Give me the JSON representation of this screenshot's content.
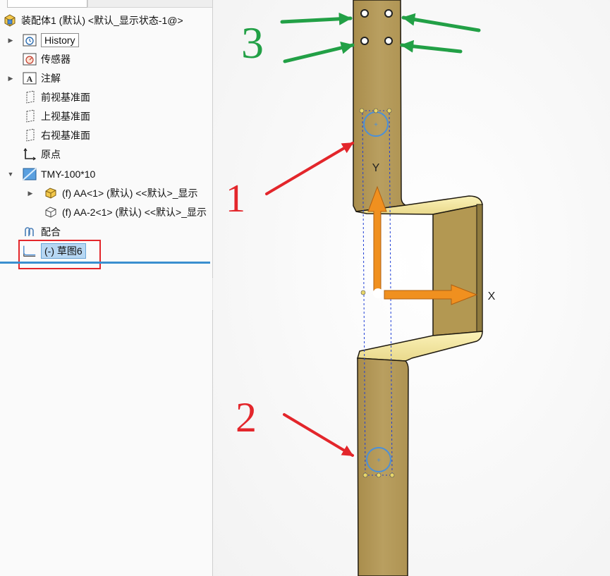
{
  "tree": {
    "root_label": "装配体1 (默认) <默认_显示状态-1@>",
    "items": [
      {
        "label": "History",
        "icon": "history-icon",
        "expandable": true
      },
      {
        "label": "传感器",
        "icon": "sensor-icon",
        "expandable": false
      },
      {
        "label": "注解",
        "icon": "annotation-icon",
        "expandable": true
      },
      {
        "label": "前视基准面",
        "icon": "plane-icon",
        "expandable": false
      },
      {
        "label": "上视基准面",
        "icon": "plane-icon",
        "expandable": false
      },
      {
        "label": "右视基准面",
        "icon": "plane-icon",
        "expandable": false
      },
      {
        "label": "原点",
        "icon": "origin-icon",
        "expandable": false
      },
      {
        "label": "TMY-100*10",
        "icon": "material-icon",
        "expandable": true,
        "expanded": true
      },
      {
        "label": "(f) AA<1> (默认) <<默认>_显示",
        "icon": "part-icon",
        "expandable": true
      },
      {
        "label": "(f) AA-2<1> (默认) <<默认>_显示",
        "icon": "part-outline-icon",
        "expandable": false
      },
      {
        "label": "配合",
        "icon": "mates-icon",
        "expandable": false
      },
      {
        "label": "(-) 草图6",
        "icon": "sketch-icon",
        "expandable": false,
        "selected": true
      }
    ]
  },
  "viewport": {
    "axis_x_label": "X",
    "axis_y_label": "Y",
    "annotations": [
      "3",
      "1",
      "2"
    ]
  },
  "colors": {
    "part_gold": "#b59a59",
    "part_highlight": "#f6eba5",
    "axis_orange": "#f0901f",
    "annotation_red": "#e3262b",
    "annotation_green": "#22a046",
    "sketch_blue": "#4a90d9",
    "selection_blue": "#b7d7f3"
  }
}
